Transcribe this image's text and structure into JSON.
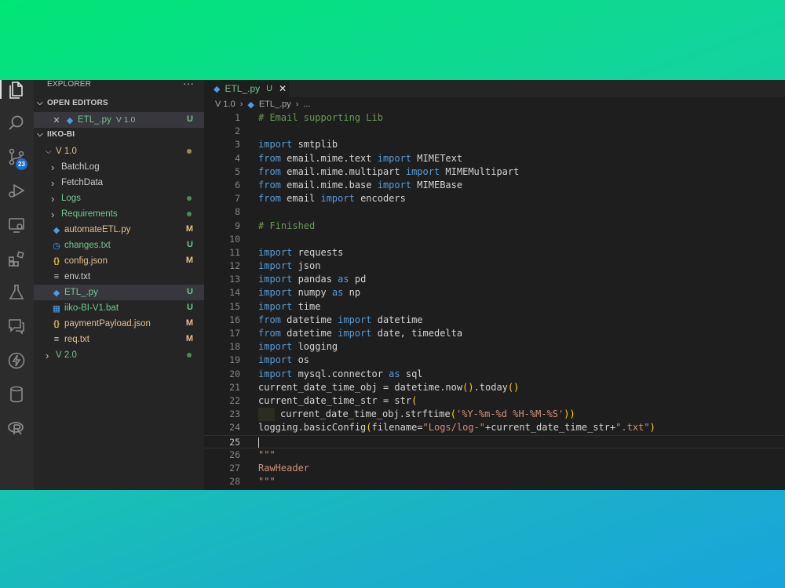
{
  "activity": {
    "icons": [
      "explorer-icon",
      "search-icon",
      "source-control-icon",
      "run-debug-icon",
      "remote-explorer-icon",
      "extensions-icon",
      "testing-icon",
      "comments-icon",
      "lightning-icon",
      "database-icon",
      "r-icon"
    ],
    "scm_badge": "23"
  },
  "sidebar": {
    "title": "EXPLORER",
    "menu": "···",
    "open_editors_label": "OPEN EDITORS",
    "open_editor": {
      "close": "✕",
      "name": "ETL_.py",
      "folder": "V 1.0",
      "status": "U"
    },
    "workspace_label": "IIKO-BI",
    "tree": [
      {
        "kind": "folder",
        "open": true,
        "name": "V 1.0",
        "status": "",
        "dot": true
      },
      {
        "kind": "folder",
        "open": false,
        "name": "BatchLog",
        "status": ""
      },
      {
        "kind": "folder",
        "open": false,
        "name": "FetchData",
        "status": ""
      },
      {
        "kind": "folder",
        "open": false,
        "name": "Logs",
        "status": "",
        "dot": true
      },
      {
        "kind": "folder",
        "open": false,
        "name": "Requirements",
        "status": "",
        "dot": true
      },
      {
        "kind": "file",
        "icon": "python",
        "name": "automateETL.py",
        "status": "M"
      },
      {
        "kind": "file",
        "icon": "clock",
        "name": "changes.txt",
        "status": "U"
      },
      {
        "kind": "file",
        "icon": "json",
        "name": "config.json",
        "status": "M"
      },
      {
        "kind": "file",
        "icon": "lines",
        "name": "env.txt",
        "status": ""
      },
      {
        "kind": "file",
        "icon": "python",
        "name": "ETL_.py",
        "status": "U",
        "selected": true
      },
      {
        "kind": "file",
        "icon": "windows",
        "name": "iiko-BI-V1.bat",
        "status": "U"
      },
      {
        "kind": "file",
        "icon": "json",
        "name": "paymentPayload.json",
        "status": "M"
      },
      {
        "kind": "file",
        "icon": "lines",
        "name": "req.txt",
        "status": "M"
      },
      {
        "kind": "folder",
        "open": false,
        "name": "V 2.0",
        "status": "",
        "dot": true
      }
    ]
  },
  "tab": {
    "name": "ETL_.py",
    "status": "U",
    "close": "✕"
  },
  "breadcrumb": [
    "V 1.0",
    "ETL_.py",
    "..."
  ],
  "colors": {
    "comment": "#6a9955",
    "keyword": "#569cd6",
    "string": "#ce9178",
    "function": "#dcdcaa"
  },
  "code_lines": [
    [
      [
        "cm",
        "# Email supporting Lib"
      ]
    ],
    [],
    [
      [
        "kw",
        "import"
      ],
      [
        "",
        "smtplib"
      ]
    ],
    [
      [
        "kw",
        "from"
      ],
      [
        "",
        "email.mime.text "
      ],
      [
        "kw",
        "import"
      ],
      [
        "",
        "MIMEText"
      ]
    ],
    [
      [
        "kw",
        "from"
      ],
      [
        "",
        "email.mime.multipart "
      ],
      [
        "kw",
        "import"
      ],
      [
        "",
        "MIMEMultipart"
      ]
    ],
    [
      [
        "kw",
        "from"
      ],
      [
        "",
        "email.mime.base "
      ],
      [
        "kw",
        "import"
      ],
      [
        "",
        "MIMEBase"
      ]
    ],
    [
      [
        "kw",
        "from"
      ],
      [
        "",
        "email "
      ],
      [
        "kw",
        "import"
      ],
      [
        "",
        "encoders"
      ]
    ],
    [],
    [
      [
        "cm",
        "# Finished"
      ]
    ],
    [],
    [
      [
        "kw",
        "import"
      ],
      [
        "",
        "requests"
      ]
    ],
    [
      [
        "kw",
        "import"
      ],
      [
        "",
        "json"
      ]
    ],
    [
      [
        "kw",
        "import"
      ],
      [
        "",
        "pandas "
      ],
      [
        "kw",
        "as"
      ],
      [
        "",
        "pd"
      ]
    ],
    [
      [
        "kw",
        "import"
      ],
      [
        "",
        "numpy "
      ],
      [
        "kw",
        "as"
      ],
      [
        "",
        "np"
      ]
    ],
    [
      [
        "kw",
        "import"
      ],
      [
        "",
        "time"
      ]
    ],
    [
      [
        "kw",
        "from"
      ],
      [
        "",
        "datetime "
      ],
      [
        "kw",
        "import"
      ],
      [
        "",
        "datetime"
      ]
    ],
    [
      [
        "kw",
        "from"
      ],
      [
        "",
        "datetime "
      ],
      [
        "kw",
        "import"
      ],
      [
        "",
        "date, timedelta"
      ]
    ],
    [
      [
        "kw",
        "import"
      ],
      [
        "",
        "logging"
      ]
    ],
    [
      [
        "kw",
        "import"
      ],
      [
        "",
        "os"
      ]
    ],
    [
      [
        "kw",
        "import"
      ],
      [
        "",
        "mysql.connector "
      ],
      [
        "kw",
        "as"
      ],
      [
        "",
        "sql"
      ]
    ],
    [
      [
        "",
        "current_date_time_obj = datetime.now"
      ],
      [
        "pn",
        "()"
      ],
      [
        "",
        ".today"
      ],
      [
        "pn",
        "()"
      ]
    ],
    [
      [
        "",
        "current_date_time_str = str"
      ],
      [
        "pn",
        "("
      ]
    ],
    [
      [
        "indent",
        ""
      ],
      [
        "",
        "current_date_time_obj.strftime"
      ],
      [
        "pn",
        "("
      ],
      [
        "st",
        "'%Y-%m-%d %H-%M-%S'"
      ],
      [
        "pn",
        ")"
      ],
      [
        "pn",
        ")"
      ]
    ],
    [
      [
        "",
        "logging.basicConfig"
      ],
      [
        "pn",
        "("
      ],
      [
        "",
        "filename="
      ],
      [
        "st",
        "\"Logs/log-\""
      ],
      [
        "",
        "+current_date_time_str+"
      ],
      [
        "st",
        "\".txt\""
      ],
      [
        "pn",
        ")"
      ]
    ],
    [
      [
        "caret",
        ""
      ]
    ],
    [
      [
        "st",
        "\"\"\""
      ]
    ],
    [
      [
        "st",
        "RawHeader"
      ]
    ],
    [
      [
        "st",
        "\"\"\""
      ]
    ]
  ]
}
